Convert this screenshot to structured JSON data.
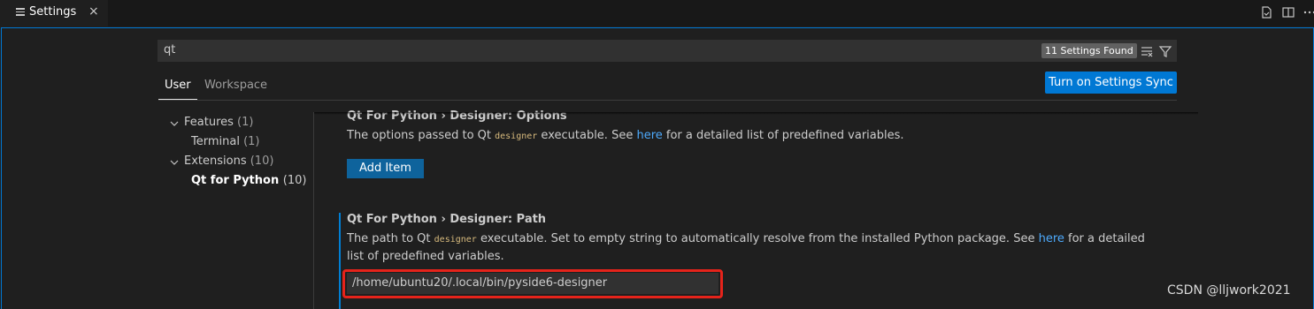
{
  "tab": {
    "label": "Settings",
    "close": "×",
    "icon": "settings-lines-icon"
  },
  "tabbar_actions": [
    "open-json-icon",
    "split-editor-icon",
    "more-icon"
  ],
  "search": {
    "value": "qt",
    "count": "11 Settings Found"
  },
  "scopes": {
    "user": "User",
    "workspace": "Workspace"
  },
  "sync_button": "Turn on Settings Sync",
  "toc": [
    {
      "label": "Features",
      "count": "(1)"
    },
    {
      "label": "Terminal",
      "count": "(1)"
    },
    {
      "label": "Extensions",
      "count": "(10)"
    },
    {
      "label": "Qt for Python",
      "count": "(10)"
    }
  ],
  "settings": {
    "options": {
      "category": "Qt For Python › Designer: ",
      "name": "Options",
      "desc_before": "The options passed to Qt ",
      "code": "designer",
      "desc_middle": " executable. See ",
      "link": "here",
      "desc_after": " for a detailed list of predefined variables.",
      "button": "Add Item"
    },
    "path": {
      "category": "Qt For Python › Designer: ",
      "name": "Path",
      "desc_before": "The path to Qt ",
      "code": "designer",
      "desc_middle": " executable. Set to empty string to automatically resolve from the installed Python package. See ",
      "link": "here",
      "desc_after": " for a detailed list of predefined variables.",
      "value": "/home/ubuntu20/.local/bin/pyside6-designer"
    }
  },
  "watermark": "CSDN @lljwork2021",
  "colors": {
    "accent": "#0078d4",
    "link": "#4daafc",
    "highlight": "#e5231b"
  }
}
